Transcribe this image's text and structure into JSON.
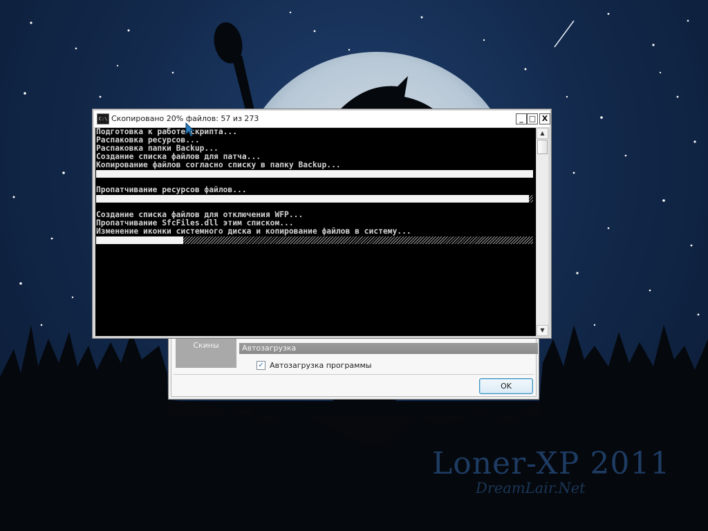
{
  "console": {
    "title": "Скопировано 20% файлов: 57 из 273",
    "icon_text": "C:\\",
    "controls": {
      "minimize": "_",
      "maximize": "□",
      "close": "X"
    },
    "lines": [
      {
        "type": "text",
        "text": "Подготовка к работе скрипта..."
      },
      {
        "type": "text",
        "text": "Распаковка ресурсов..."
      },
      {
        "type": "text",
        "text": "Распаковка папки Backup..."
      },
      {
        "type": "text",
        "text": "Создание списка файлов для патча..."
      },
      {
        "type": "text",
        "text": "Копирование файлов согласно списку в папку Backup..."
      },
      {
        "type": "progress",
        "value": 1.0
      },
      {
        "type": "text",
        "text": ""
      },
      {
        "type": "text",
        "text": "Пропатчивание ресурсов файлов..."
      },
      {
        "type": "progress",
        "value": 0.99
      },
      {
        "type": "text",
        "text": ""
      },
      {
        "type": "text",
        "text": "Создание списка файлов для отключения WFP..."
      },
      {
        "type": "text",
        "text": "Пропатчивание SfcFiles.dll этим списком..."
      },
      {
        "type": "text",
        "text": "Изменение иконки системного диска и копирование файлов в систему..."
      },
      {
        "type": "progress",
        "value": 0.2
      }
    ],
    "scrollbar": {
      "up_arrow": "▲",
      "down_arrow": "▼"
    }
  },
  "settings_dialog": {
    "skins_tile_label": "Скины",
    "autoload_group": "Автозагрузка",
    "autoload_checkbox_label": "Автозагрузка программы",
    "autoload_checked": true,
    "checkbox_mark": "✓",
    "ok_label": "OK"
  },
  "wallpaper": {
    "watermark_title": "Loner-XP 2011",
    "watermark_subtitle": "DreamLair.Net"
  }
}
